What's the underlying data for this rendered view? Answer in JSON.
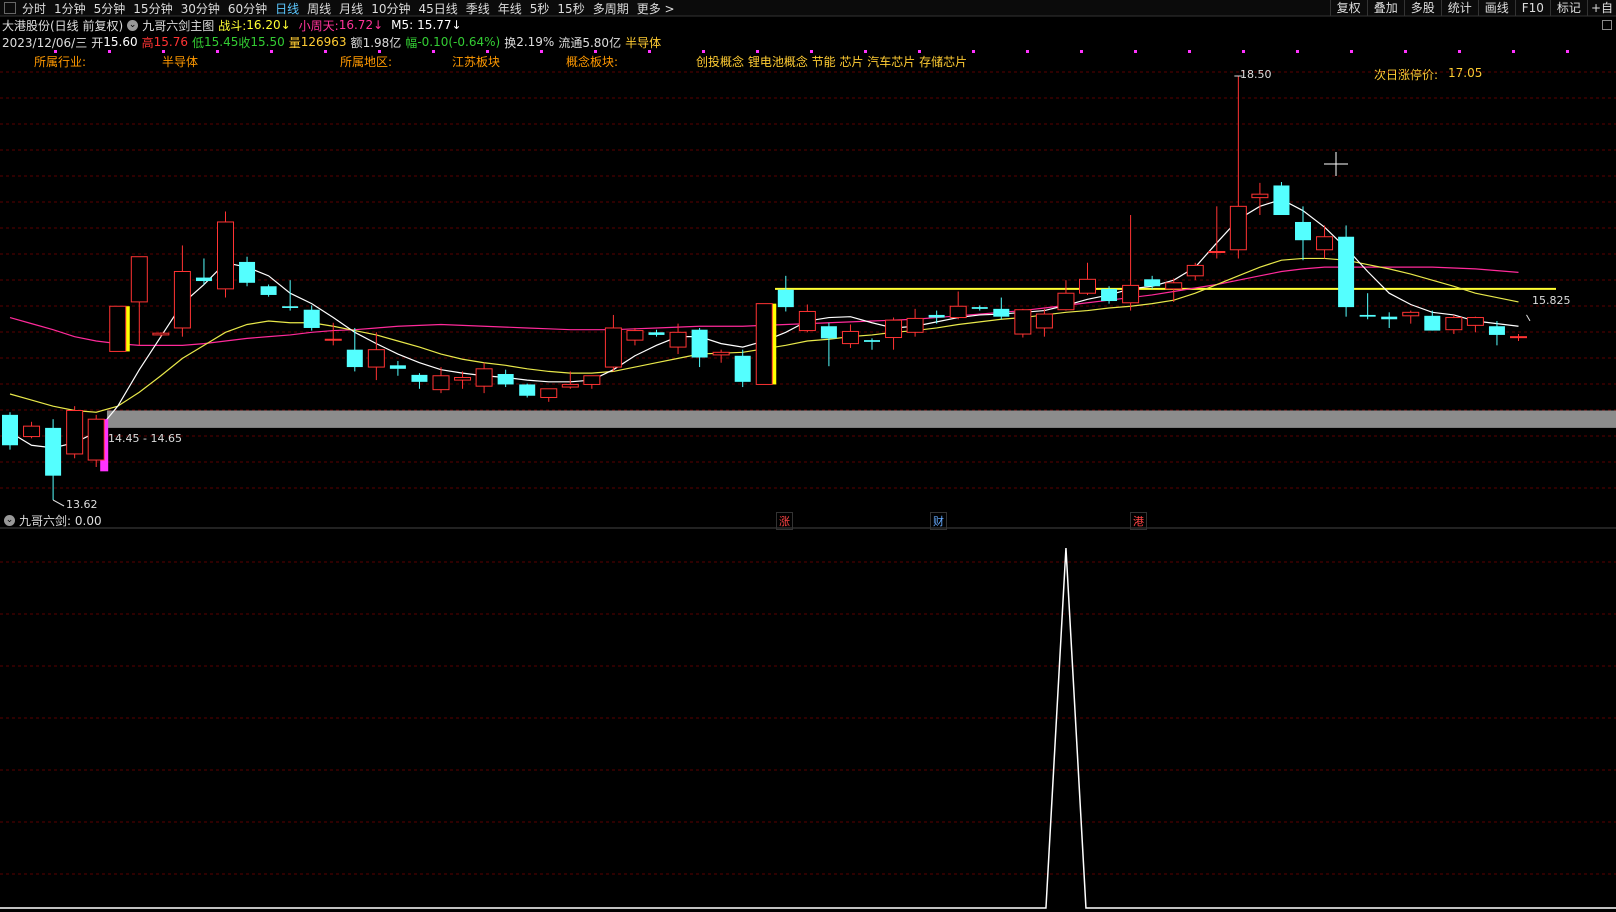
{
  "toolbar": {
    "periods": [
      "分时",
      "1分钟",
      "5分钟",
      "15分钟",
      "30分钟",
      "60分钟",
      "日线",
      "周线",
      "月线",
      "10分钟",
      "45日线",
      "季线",
      "年线",
      "5秒",
      "15秒",
      "多周期",
      "更多 >"
    ],
    "active_period": "日线",
    "right_buttons": [
      "复权",
      "叠加",
      "多股",
      "统计",
      "画线",
      "F10",
      "标记",
      "+自"
    ]
  },
  "header": {
    "stock_name": "大港股份(日线 前复权)",
    "indicator_name": "九哥六剑主图",
    "zhandou_label": "战斗:",
    "zhandou_value": "16.20",
    "xiaozhoutian_label": "小周天:",
    "xiaozhoutian_value": "16.72",
    "m5_label": "M5:",
    "m5_value": "15.77"
  },
  "quote": {
    "date": "2023/12/06/三",
    "open_label": "开",
    "open": "15.60",
    "high_label": "高",
    "high": "15.76",
    "low_label": "低",
    "low": "15.45",
    "close_label": "收",
    "close": "15.50",
    "vol_label": "量",
    "volume": "126963",
    "amount_label": "额",
    "amount": "1.98亿",
    "change_label": "幅",
    "change": "-0.10(-0.64%)",
    "turnover_label": "换",
    "turnover": "2.19%",
    "float_label": "流通",
    "float_value": "5.80亿",
    "sector": "半导体"
  },
  "info": {
    "industry_label": "所属行业:",
    "industry": "半导体",
    "region_label": "所属地区:",
    "region": "江苏板块",
    "concept_label": "概念板块:",
    "concepts": "创投概念 锂电池概念 节能 芯片 汽车芯片 存储芯片",
    "limit_label": "次日涨停价:",
    "limit_price": "17.05"
  },
  "annotations": {
    "high": "18.50",
    "low": "13.62",
    "range": "14.45 - 14.65",
    "last": "15.825"
  },
  "event_markers": [
    "涨",
    "财",
    "港"
  ],
  "sub_indicator": {
    "name": "九哥六剑",
    "value": ": 0.00"
  },
  "colors": {
    "up": "#ff3333",
    "down": "#54ffff",
    "ma_white": "#ffffff",
    "ma_yellow": "#e8e84a",
    "ma_magenta": "#ff2a9a",
    "support_band": "#8c8c8c",
    "resistance_line": "#ffff33",
    "grid": "#5a0000"
  },
  "chart_data": {
    "type": "candlestick",
    "price_range": [
      13.62,
      18.5
    ],
    "candles": [
      {
        "o": 14.6,
        "h": 14.63,
        "l": 14.2,
        "c": 14.25
      },
      {
        "o": 14.35,
        "h": 14.52,
        "l": 14.33,
        "c": 14.47
      },
      {
        "o": 14.45,
        "h": 14.55,
        "l": 13.62,
        "c": 13.9
      },
      {
        "o": 14.15,
        "h": 14.7,
        "l": 14.1,
        "c": 14.65
      },
      {
        "o": 14.08,
        "h": 14.6,
        "l": 14.0,
        "c": 14.55
      },
      {
        "o": 15.33,
        "h": 15.85,
        "l": 15.33,
        "c": 15.85
      },
      {
        "o": 15.9,
        "h": 16.42,
        "l": 15.4,
        "c": 16.42
      },
      {
        "o": 15.52,
        "h": 15.55,
        "l": 15.5,
        "c": 15.54
      },
      {
        "o": 15.6,
        "h": 16.55,
        "l": 15.5,
        "c": 16.25
      },
      {
        "o": 16.18,
        "h": 16.4,
        "l": 16.1,
        "c": 16.14
      },
      {
        "o": 16.05,
        "h": 16.94,
        "l": 15.95,
        "c": 16.82
      },
      {
        "o": 16.36,
        "h": 16.42,
        "l": 16.08,
        "c": 16.12
      },
      {
        "o": 16.08,
        "h": 16.1,
        "l": 15.96,
        "c": 15.98
      },
      {
        "o": 15.85,
        "h": 16.15,
        "l": 15.8,
        "c": 15.83
      },
      {
        "o": 15.81,
        "h": 15.86,
        "l": 15.57,
        "c": 15.6
      },
      {
        "o": 15.47,
        "h": 15.66,
        "l": 15.4,
        "c": 15.47
      },
      {
        "o": 15.35,
        "h": 15.6,
        "l": 15.1,
        "c": 15.15
      },
      {
        "o": 15.15,
        "h": 15.55,
        "l": 15.0,
        "c": 15.35
      },
      {
        "o": 15.17,
        "h": 15.22,
        "l": 15.05,
        "c": 15.13
      },
      {
        "o": 15.06,
        "h": 15.08,
        "l": 14.9,
        "c": 14.98
      },
      {
        "o": 14.89,
        "h": 15.15,
        "l": 14.85,
        "c": 15.05
      },
      {
        "o": 15.0,
        "h": 15.1,
        "l": 14.9,
        "c": 15.03
      },
      {
        "o": 14.93,
        "h": 15.2,
        "l": 14.85,
        "c": 15.13
      },
      {
        "o": 15.07,
        "h": 15.12,
        "l": 14.92,
        "c": 14.95
      },
      {
        "o": 14.95,
        "h": 14.96,
        "l": 14.8,
        "c": 14.82
      },
      {
        "o": 14.8,
        "h": 14.9,
        "l": 14.75,
        "c": 14.9
      },
      {
        "o": 14.92,
        "h": 15.1,
        "l": 14.9,
        "c": 14.95
      },
      {
        "o": 14.95,
        "h": 15.05,
        "l": 14.9,
        "c": 15.05
      },
      {
        "o": 15.15,
        "h": 15.75,
        "l": 15.1,
        "c": 15.6
      },
      {
        "o": 15.46,
        "h": 15.6,
        "l": 15.4,
        "c": 15.57
      },
      {
        "o": 15.55,
        "h": 15.58,
        "l": 15.5,
        "c": 15.52
      },
      {
        "o": 15.38,
        "h": 15.65,
        "l": 15.3,
        "c": 15.55
      },
      {
        "o": 15.58,
        "h": 15.6,
        "l": 15.15,
        "c": 15.26
      },
      {
        "o": 15.29,
        "h": 15.35,
        "l": 15.2,
        "c": 15.32
      },
      {
        "o": 15.28,
        "h": 15.35,
        "l": 14.92,
        "c": 14.98
      },
      {
        "o": 14.95,
        "h": 15.88,
        "l": 14.95,
        "c": 15.88
      },
      {
        "o": 16.04,
        "h": 16.2,
        "l": 15.79,
        "c": 15.84
      },
      {
        "o": 15.57,
        "h": 15.87,
        "l": 15.55,
        "c": 15.79
      },
      {
        "o": 15.62,
        "h": 15.66,
        "l": 15.16,
        "c": 15.48
      },
      {
        "o": 15.42,
        "h": 15.64,
        "l": 15.37,
        "c": 15.56
      },
      {
        "o": 15.46,
        "h": 15.48,
        "l": 15.35,
        "c": 15.44
      },
      {
        "o": 15.49,
        "h": 15.72,
        "l": 15.35,
        "c": 15.69
      },
      {
        "o": 15.55,
        "h": 15.82,
        "l": 15.5,
        "c": 15.71
      },
      {
        "o": 15.75,
        "h": 15.8,
        "l": 15.65,
        "c": 15.72
      },
      {
        "o": 15.72,
        "h": 16.02,
        "l": 15.7,
        "c": 15.85
      },
      {
        "o": 15.84,
        "h": 15.86,
        "l": 15.8,
        "c": 15.82
      },
      {
        "o": 15.82,
        "h": 15.95,
        "l": 15.7,
        "c": 15.73
      },
      {
        "o": 15.53,
        "h": 15.82,
        "l": 15.49,
        "c": 15.81
      },
      {
        "o": 15.6,
        "h": 15.82,
        "l": 15.5,
        "c": 15.76
      },
      {
        "o": 15.81,
        "h": 16.15,
        "l": 15.8,
        "c": 16.0
      },
      {
        "o": 16.0,
        "h": 16.35,
        "l": 15.98,
        "c": 16.16
      },
      {
        "o": 16.05,
        "h": 16.08,
        "l": 15.88,
        "c": 15.91
      },
      {
        "o": 15.89,
        "h": 16.9,
        "l": 15.8,
        "c": 16.09
      },
      {
        "o": 16.16,
        "h": 16.2,
        "l": 16.05,
        "c": 16.08
      },
      {
        "o": 16.05,
        "h": 16.17,
        "l": 15.9,
        "c": 16.12
      },
      {
        "o": 16.2,
        "h": 16.35,
        "l": 16.15,
        "c": 16.32
      },
      {
        "o": 16.48,
        "h": 17.0,
        "l": 16.4,
        "c": 16.48
      },
      {
        "o": 16.5,
        "h": 18.5,
        "l": 16.4,
        "c": 17.0
      },
      {
        "o": 17.1,
        "h": 17.27,
        "l": 16.9,
        "c": 17.14
      },
      {
        "o": 17.24,
        "h": 17.28,
        "l": 16.91,
        "c": 16.9
      },
      {
        "o": 16.82,
        "h": 17.0,
        "l": 16.38,
        "c": 16.61
      },
      {
        "o": 16.5,
        "h": 16.78,
        "l": 16.4,
        "c": 16.65
      },
      {
        "o": 16.65,
        "h": 16.78,
        "l": 15.73,
        "c": 15.84
      },
      {
        "o": 15.75,
        "h": 16.0,
        "l": 15.7,
        "c": 15.73
      },
      {
        "o": 15.73,
        "h": 15.78,
        "l": 15.6,
        "c": 15.7
      },
      {
        "o": 15.74,
        "h": 15.8,
        "l": 15.65,
        "c": 15.78
      },
      {
        "o": 15.74,
        "h": 15.8,
        "l": 15.57,
        "c": 15.57
      },
      {
        "o": 15.58,
        "h": 15.75,
        "l": 15.53,
        "c": 15.72
      },
      {
        "o": 15.63,
        "h": 15.73,
        "l": 15.55,
        "c": 15.72
      },
      {
        "o": 15.62,
        "h": 15.68,
        "l": 15.4,
        "c": 15.52
      },
      {
        "o": 15.5,
        "h": 15.53,
        "l": 15.45,
        "c": 15.5
      }
    ],
    "ma5": [
      14.4,
      14.25,
      14.22,
      14.28,
      14.4,
      14.7,
      15.12,
      15.5,
      15.88,
      16.1,
      16.35,
      16.3,
      16.2,
      16.0,
      15.88,
      15.72,
      15.55,
      15.42,
      15.3,
      15.2,
      15.12,
      15.08,
      15.05,
      15.03,
      15.0,
      14.98,
      14.98,
      15.0,
      15.12,
      15.28,
      15.4,
      15.5,
      15.5,
      15.42,
      15.38,
      15.45,
      15.55,
      15.68,
      15.72,
      15.73,
      15.66,
      15.6,
      15.62,
      15.67,
      15.72,
      15.75,
      15.76,
      15.78,
      15.8,
      15.86,
      15.93,
      15.98,
      16.05,
      16.08,
      16.15,
      16.3,
      16.58,
      16.85,
      17.0,
      17.08,
      16.95,
      16.76,
      16.52,
      16.25,
      16.0,
      15.87,
      15.78,
      15.75,
      15.68,
      15.65,
      15.62
    ],
    "ma20": [
      14.84,
      14.77,
      14.7,
      14.65,
      14.63,
      14.7,
      14.86,
      15.05,
      15.25,
      15.4,
      15.55,
      15.64,
      15.68,
      15.66,
      15.66,
      15.62,
      15.57,
      15.52,
      15.45,
      15.38,
      15.3,
      15.24,
      15.2,
      15.17,
      15.13,
      15.1,
      15.08,
      15.08,
      15.1,
      15.15,
      15.2,
      15.25,
      15.3,
      15.31,
      15.32,
      15.36,
      15.4,
      15.45,
      15.47,
      15.5,
      15.52,
      15.55,
      15.57,
      15.6,
      15.64,
      15.67,
      15.7,
      15.72,
      15.75,
      15.78,
      15.8,
      15.83,
      15.85,
      15.88,
      15.92,
      16.0,
      16.1,
      16.2,
      16.3,
      16.38,
      16.4,
      16.4,
      16.38,
      16.33,
      16.28,
      16.22,
      16.15,
      16.08,
      16.0,
      15.95,
      15.9
    ],
    "ma60": [
      15.72,
      15.65,
      15.58,
      15.5,
      15.45,
      15.42,
      15.4,
      15.4,
      15.4,
      15.42,
      15.45,
      15.48,
      15.5,
      15.52,
      15.55,
      15.57,
      15.58,
      15.6,
      15.62,
      15.63,
      15.64,
      15.63,
      15.62,
      15.61,
      15.6,
      15.59,
      15.58,
      15.58,
      15.58,
      15.59,
      15.6,
      15.61,
      15.62,
      15.62,
      15.62,
      15.63,
      15.64,
      15.65,
      15.66,
      15.67,
      15.68,
      15.69,
      15.7,
      15.72,
      15.74,
      15.76,
      15.78,
      15.8,
      15.83,
      15.86,
      15.89,
      15.92,
      15.95,
      15.98,
      16.02,
      16.06,
      16.1,
      16.15,
      16.2,
      16.25,
      16.28,
      16.3,
      16.3,
      16.3,
      16.3,
      16.3,
      16.3,
      16.29,
      16.28,
      16.26,
      16.24
    ],
    "signal_bars": [
      {
        "index": 4,
        "color": "magenta",
        "from": 13.95,
        "to": 14.55
      },
      {
        "index": 5,
        "color": "yellow",
        "from": 15.33,
        "to": 15.85
      },
      {
        "index": 35,
        "color": "yellow",
        "from": 14.95,
        "to": 15.88
      }
    ],
    "resistance_level": 16.05,
    "support_band": [
      14.45,
      14.65
    ],
    "sub_series": {
      "peak_index": 49,
      "peak_value": 1.0,
      "baseline": 0.0
    }
  }
}
